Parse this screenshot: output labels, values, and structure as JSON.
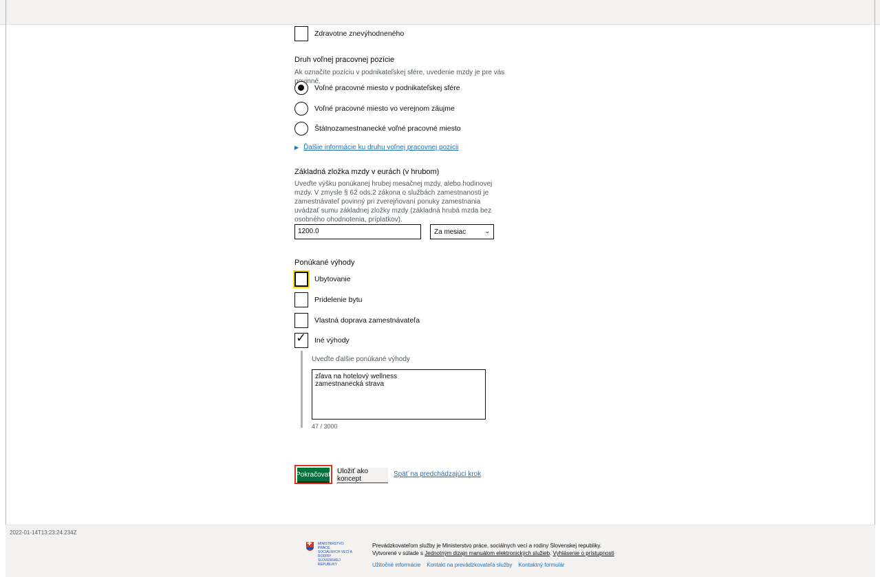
{
  "form": {
    "disabled_checkbox_label": "Zdravotne znevýhodneného",
    "position_type": {
      "heading": "Druh voľnej pracovnej pozície",
      "hint": "Ak označíte pozíciu v podnikateľskej sfére, uvedenie mzdy je pre vás povinné.",
      "options": [
        {
          "label": "Voľné pracovné miesto v podnikateľskej sfére",
          "selected": true
        },
        {
          "label": "Voľné pracovné miesto vo verejnom záujme",
          "selected": false
        },
        {
          "label": "Štátnozamestnanecké voľné pracovné miesto",
          "selected": false
        }
      ],
      "details_link": "Ďalšie informácie ku druhu voľnej pracovnej pozícii"
    },
    "salary": {
      "heading": "Základná zložka mzdy v eurách (v hrubom)",
      "hint": "Uveďte výšku ponúkanej hrubej mesačnej mzdy, alebo hodinovej mzdy. V zmysle § 62 ods.2 zákona o službách zamestnanosti je zamestnávateľ povinný pri zverejňovaní ponuky zamestnania uvádzať sumu základnej zložky mzdy (základná hrubá mzda bez osobného ohodnotenia, príplatkov).",
      "value": "1200.0",
      "period": "Za mesiac"
    },
    "benefits": {
      "heading": "Ponúkané výhody",
      "options": [
        {
          "label": "Ubytovanie",
          "checked": false
        },
        {
          "label": "Pridelenie bytu",
          "checked": false
        },
        {
          "label": "Vlastná doprava zamestnávateľa",
          "checked": false
        },
        {
          "label": "Iné výhody",
          "checked": true
        }
      ],
      "other_label": "Uveďte ďalšie ponúkané výhody",
      "other_value": "zľava na hotelový wellness\nzamestnanecká strava",
      "counter": "47 / 3000"
    }
  },
  "actions": {
    "continue": "Pokračovať",
    "save_draft": "Uložiť ako koncept",
    "back": "Späť na predchádzajúci krok"
  },
  "footer": {
    "timestamp": "2022-01-14T13:23:24.234Z",
    "crest_text": "Ministerstvo práce, sociálnych vecí a rodiny Slovenskej republiky",
    "operator_text": "Prevádzkovateľom služby je Ministerstvo práce, sociálnych vecí a rodiny Slovenskej republiky. Vytvorené v súlade s",
    "manual_link": "Jednotným dizajn manuálom elektronických služieb",
    "accessibility_link": "Vyhlásenie o prístupnosti",
    "links": [
      "Užitočné informácie",
      "Kontakt na prevádzkovateľa služby",
      "Kontaktný formulár"
    ]
  },
  "colors": {
    "primary_button": "#00703c",
    "focus_outline": "#d4351c",
    "focus_highlight": "#ffdd00",
    "link": "#1d70b8"
  }
}
